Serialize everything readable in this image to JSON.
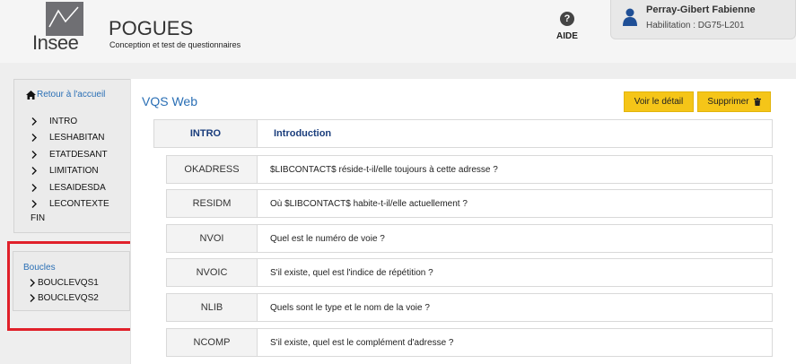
{
  "header": {
    "logo_text": "Insee",
    "app_title": "POGUES",
    "app_subtitle": "Conception et test de questionnaires",
    "help_label": "AIDE",
    "user": {
      "name": "Perray-Gibert Fabienne",
      "role": "Habilitation : DG75-L201"
    }
  },
  "sidebar": {
    "back_link": "Retour à l'accueil",
    "items": [
      {
        "label": "INTRO"
      },
      {
        "label": "LESHABITAN"
      },
      {
        "label": "ETATDESANT"
      },
      {
        "label": "LIMITATION"
      },
      {
        "label": "LESAIDESDA"
      },
      {
        "label": "LECONTEXTE"
      }
    ],
    "end_label": "FIN"
  },
  "loops": {
    "title": "Boucles",
    "items": [
      {
        "label": "BOUCLEVQS1"
      },
      {
        "label": "BOUCLEVQS2"
      }
    ]
  },
  "main": {
    "title": "VQS Web",
    "detail_button": "Voir le détail",
    "delete_button": "Supprimer",
    "sequence": {
      "code": "INTRO",
      "label": "Introduction"
    },
    "questions": [
      {
        "code": "OKADRESS",
        "label": "$LIBCONTACT$ réside-t-il/elle toujours à cette adresse ?"
      },
      {
        "code": "RESIDM",
        "label": "Où $LIBCONTACT$ habite-t-il/elle actuellement ?"
      },
      {
        "code": "NVOI",
        "label": "Quel est le numéro de voie ?"
      },
      {
        "code": "NVOIC",
        "label": "S'il existe, quel est l'indice de répétition ?"
      },
      {
        "code": "NLIB",
        "label": "Quels sont le type et le nom de la voie ?"
      },
      {
        "code": "NCOMP",
        "label": "S'il existe, quel est le complément d'adresse ?"
      }
    ]
  },
  "colors": {
    "accent": "#2a6fb5",
    "button": "#f5c518",
    "highlight": "#e0202a",
    "sequence_text": "#1a3d7c"
  }
}
